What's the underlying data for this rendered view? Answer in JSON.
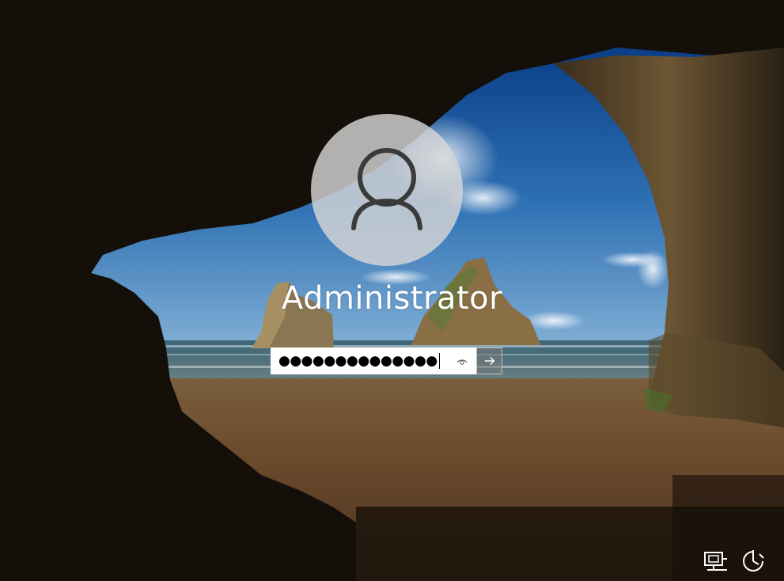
{
  "user": {
    "name": "Administrator"
  },
  "password": {
    "masked_value": "●●●●●●●●●●●●●●"
  },
  "icons": {
    "avatar": "user-silhouette-icon",
    "reveal": "eye-icon",
    "submit": "arrow-right-icon",
    "network": "network-icon",
    "accessibility": "ease-of-access-icon"
  },
  "colors": {
    "text": "#ffffff",
    "avatar_bg": "#d6d6d6",
    "field_bg": "#ffffff",
    "submit_bg": "#7a7a7a"
  }
}
